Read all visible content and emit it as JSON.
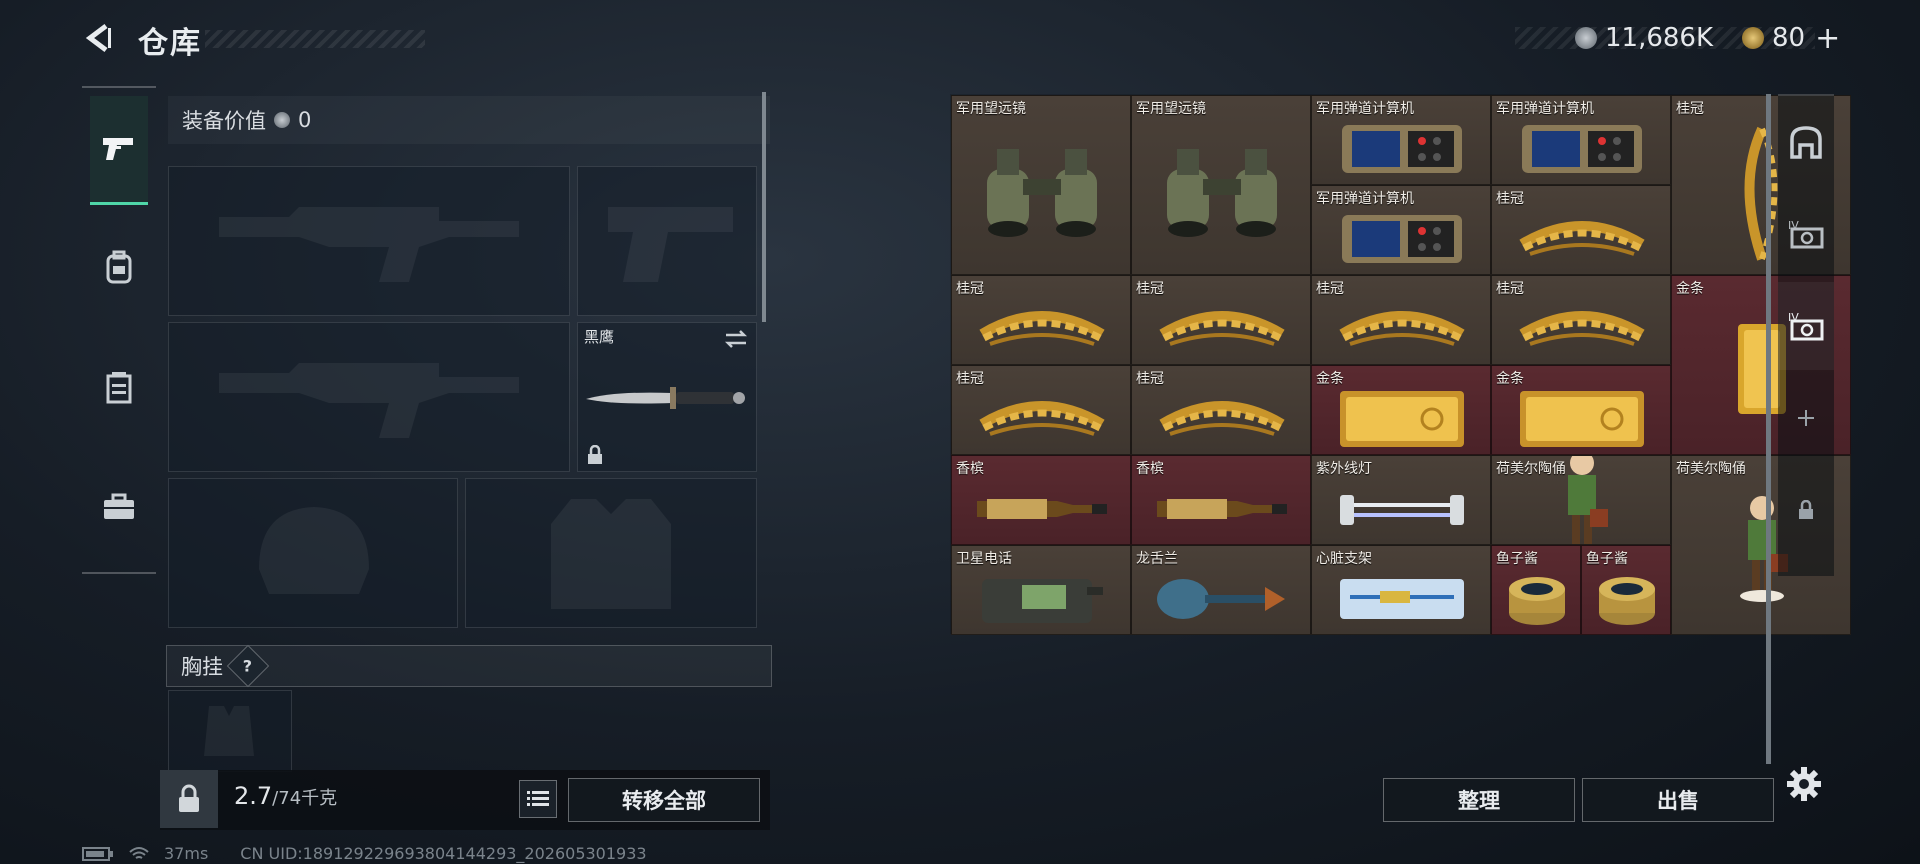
{
  "header": {
    "title": "仓库",
    "currency_main": "11,686K",
    "currency_secondary": "80",
    "add_label": "+"
  },
  "equipment": {
    "value_label": "装备价值",
    "value_amount": "0",
    "knife_slot_label": "黑鹰",
    "vest_label": "胸挂",
    "vest_help": "?"
  },
  "footer_left": {
    "weight_current": "2.7",
    "weight_max": "/74千克",
    "transfer_all": "转移全部"
  },
  "status_bar": {
    "ping": "37ms",
    "uid": "CN UID:189129229693804144293_202605301933"
  },
  "items": [
    {
      "name": "军用望远镜",
      "color": "brown"
    },
    {
      "name": "军用望远镜",
      "color": "brown"
    },
    {
      "name": "军用弹道计算机",
      "color": "brown"
    },
    {
      "name": "军用弹道计算机",
      "color": "brown"
    },
    {
      "name": "桂冠",
      "color": "brown"
    },
    {
      "name": "军用弹道计算机",
      "color": "brown"
    },
    {
      "name": "桂冠",
      "color": "brown"
    },
    {
      "name": "桂冠",
      "color": "brown"
    },
    {
      "name": "桂冠",
      "color": "brown"
    },
    {
      "name": "桂冠",
      "color": "brown"
    },
    {
      "name": "桂冠",
      "color": "brown"
    },
    {
      "name": "金条",
      "color": "red"
    },
    {
      "name": "桂冠",
      "color": "brown"
    },
    {
      "name": "桂冠",
      "color": "brown"
    },
    {
      "name": "金条",
      "color": "red"
    },
    {
      "name": "金条",
      "color": "red"
    },
    {
      "name": "香槟",
      "color": "red"
    },
    {
      "name": "香槟",
      "color": "red"
    },
    {
      "name": "紫外线灯",
      "color": "brown"
    },
    {
      "name": "荷美尔陶俑",
      "color": "brown"
    },
    {
      "name": "荷美尔陶俑",
      "color": "brown"
    },
    {
      "name": "卫星电话",
      "color": "brown"
    },
    {
      "name": "龙舌兰",
      "color": "brown"
    },
    {
      "name": "心脏支架",
      "color": "brown"
    },
    {
      "name": "鱼子酱",
      "color": "red"
    },
    {
      "name": "鱼子酱",
      "color": "red"
    }
  ],
  "actions": {
    "sort": "整理",
    "sell": "出售"
  },
  "icons": {
    "back": "back-arrow-icon",
    "pistol": "pistol-icon",
    "backpack": "backpack-icon",
    "vest": "vest-icon",
    "case": "case-icon",
    "lock": "lock-icon",
    "list": "list-icon",
    "settings": "gear-icon"
  }
}
